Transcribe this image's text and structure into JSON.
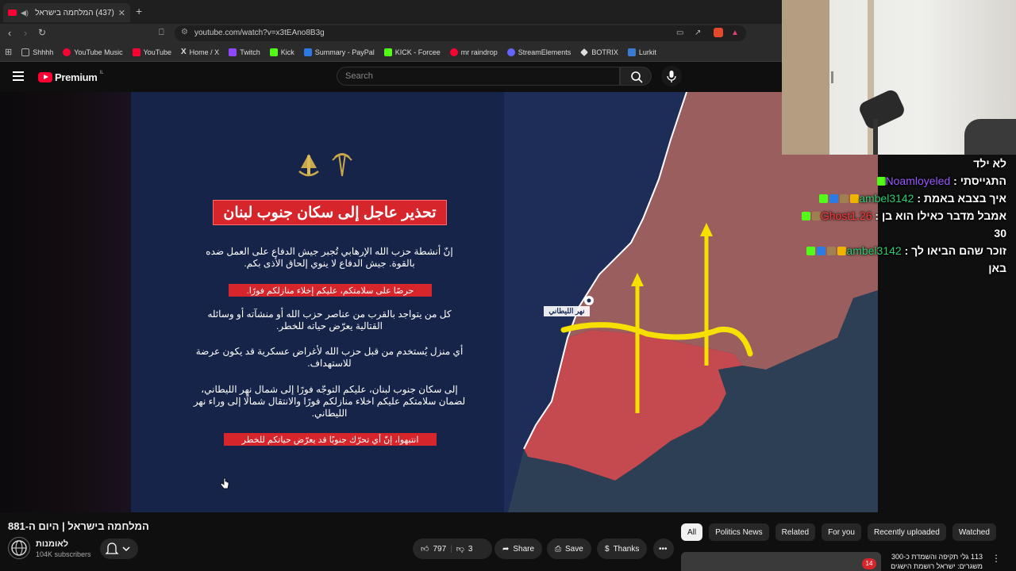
{
  "browser": {
    "tab_title": "(437) המלחמה בישראל | היום",
    "url": "youtube.com/watch?v=x3tEAno8B3g",
    "bookmarks": [
      {
        "label": "Shhhh",
        "color": "#888888"
      },
      {
        "label": "YouTube Music",
        "color": "#ff0033"
      },
      {
        "label": "YouTube",
        "color": "#ff0033"
      },
      {
        "label": "Home / X",
        "color": "#ffffff"
      },
      {
        "label": "Twitch",
        "color": "#9146ff"
      },
      {
        "label": "Kick",
        "color": "#53fc18"
      },
      {
        "label": "Summary - PayPal",
        "color": "#2c7be5"
      },
      {
        "label": "KICK - Forcee",
        "color": "#53fc18"
      },
      {
        "label": "mr raindrop",
        "color": "#ff0033"
      },
      {
        "label": "StreamElements",
        "color": "#6464ff"
      },
      {
        "label": "BOTRIX",
        "color": "#dddddd"
      },
      {
        "label": "Lurkit",
        "color": "#3a7bd5"
      }
    ]
  },
  "youtube": {
    "logo_text": "Premium",
    "logo_region": "IL",
    "search_placeholder": "Search"
  },
  "video": {
    "banner": "تحذير عاجل إلى سكان جنوب لبنان",
    "para1": "إنّ أنشطة حزب الله الإرهابي تُجبر جيش الدفاع على العمل ضده بالقوة. جيش الدفاع لا ينوي إلحاق الأذى بكم.",
    "pill1": "حرصًا على سلامتكم، عليكم إخلاء منازلكم فورًا.",
    "para2": "كل من يتواجد بالقرب من عناصر حزب الله أو منشآته أو وسائله القتالية يعرّض حياته للخطر.",
    "para3": "أي منزل يُستخدم من قبل حزب الله لأغراض عسكرية قد يكون عرضة للاستهداف.",
    "para4": "إلى سكان جنوب لبنان، عليكم التوجّه فورًا إلى شمال نهر الليطاني، لضمان سلامتكم عليكم اخلاء منازلكم فورًا والانتقال شمالًا إلى وراء نهر الليطاني.",
    "pill2": "انتبهوا، إنّ أي تحرّك جنوبًا قد يعرّض حياتكم للخطر",
    "map_label": "نهر الليطاني",
    "title": "המלחמה בישראל | היום ה-881",
    "channel": "לאומנות",
    "subscribers": "104K subscribers",
    "likes": "797",
    "dislikes": "3",
    "share": "Share",
    "save": "Save",
    "thanks": "Thanks"
  },
  "chat": {
    "lines": [
      {
        "user": "",
        "text": "לא ילד",
        "color": "#ffffff"
      },
      {
        "user": "Noamloyeled",
        "text": "התגייסתי",
        "color": "#9b59ff"
      },
      {
        "user": "ambel3142",
        "text": "איך בצבא באמת",
        "color": "#2ecc71"
      },
      {
        "user": "Ghost1.26",
        "text": "אמבל מדבר כאילו הוא בן",
        "color": "#ff3b3b"
      },
      {
        "user": "",
        "text": "30",
        "color": "#ffffff"
      },
      {
        "user": "ambel3142",
        "text": "זוכר שהם הביאו לך",
        "color": "#2ecc71"
      },
      {
        "user": "",
        "text": "באן",
        "color": "#ffffff"
      }
    ]
  },
  "chips": [
    "All",
    "Politics News",
    "Related",
    "For you",
    "Recently uploaded",
    "Watched"
  ],
  "recommended": {
    "title": "113 גלי תקיפה והשמדת כ-300 משגרים: ישראל רושמת הישגים",
    "badge": "14"
  }
}
